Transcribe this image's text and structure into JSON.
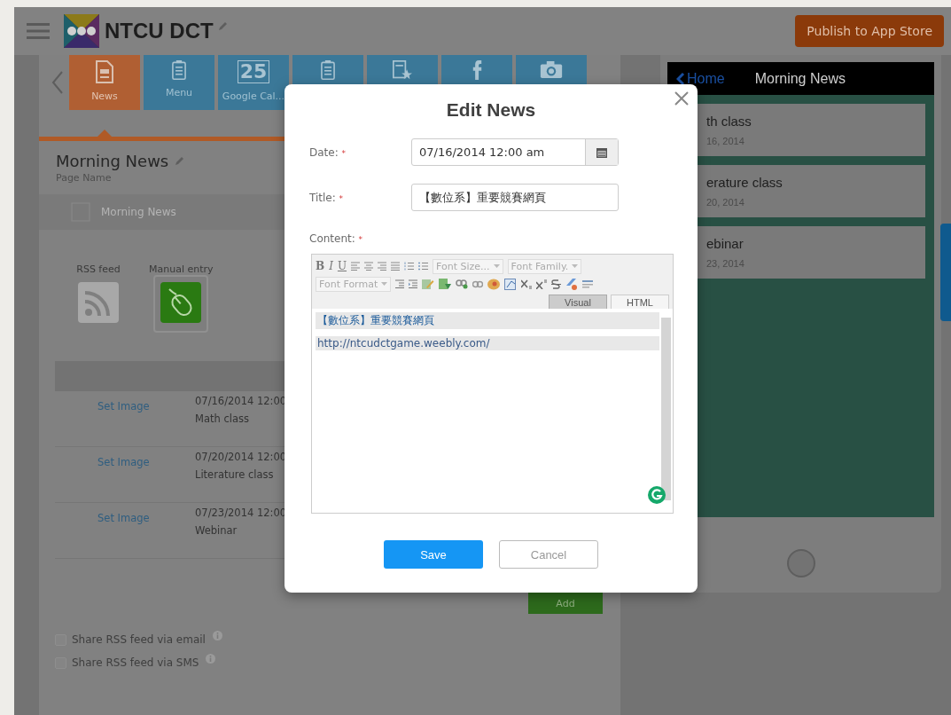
{
  "header": {
    "title": "NTCU DCT",
    "publish_button": "Publish to App Store"
  },
  "feature_tiles": [
    {
      "label": "News",
      "kind": "document",
      "selected": true
    },
    {
      "label": "Menu",
      "kind": "list",
      "selected": false
    },
    {
      "label": "Google Cal...",
      "kind": "calendar",
      "glyph": "25",
      "selected": false
    },
    {
      "kind": "list",
      "selected": false
    },
    {
      "kind": "star-list",
      "selected": false
    },
    {
      "kind": "facebook",
      "selected": false
    },
    {
      "kind": "camera",
      "selected": false
    }
  ],
  "page": {
    "name": "Morning News",
    "caption": "Page Name",
    "faint_title": "Morning News"
  },
  "sources": [
    {
      "label": "RSS feed",
      "kind": "rss",
      "selected": false
    },
    {
      "label": "Manual entry",
      "kind": "manual",
      "selected": true
    }
  ],
  "news_rows": [
    {
      "link": "Set Image",
      "date": "07/16/2014 12:00",
      "title": "Math class"
    },
    {
      "link": "Set Image",
      "date": "07/20/2014 12:00",
      "title": "Literature class"
    },
    {
      "link": "Set Image",
      "date": "07/23/2014 12:00",
      "title": "Webinar"
    }
  ],
  "add_button": "Add",
  "share_options": [
    {
      "label": "Share RSS feed via email",
      "checked": false
    },
    {
      "label": "Share RSS feed via SMS",
      "checked": false
    }
  ],
  "preview": {
    "back": "Home",
    "title": "Morning News",
    "cards": [
      {
        "title": "th class",
        "date": "16, 2014"
      },
      {
        "title": "erature class",
        "date": "20, 2014"
      },
      {
        "title": "ebinar",
        "date": "23, 2014"
      }
    ]
  },
  "dialog": {
    "title": "Edit News",
    "fields": [
      {
        "kind": "date",
        "label": "Date:",
        "mark": "*",
        "value": "07/16/2014 12:00 am"
      },
      {
        "kind": "text",
        "label": "Title:",
        "mark": "*",
        "value": "【數位系】重要競賽網頁"
      },
      {
        "kind": "editor",
        "label": "Content:",
        "mark": "*"
      }
    ],
    "format_buttons": [
      "B",
      "I",
      "U"
    ],
    "dropdowns_row1": [
      "Font Size...",
      "Font Family."
    ],
    "dropdowns_row2": [
      "Font Format"
    ],
    "editor_tabs": [
      {
        "label": "Visual",
        "selected": true
      },
      {
        "label": "HTML",
        "selected": false
      }
    ],
    "content_lines": [
      "【數位系】重要競賽網頁",
      "http://ntcudctgame.weebly.com/"
    ],
    "buttons": [
      {
        "label": "Save",
        "kind": "primary"
      },
      {
        "label": "Cancel",
        "kind": "secondary"
      }
    ]
  }
}
